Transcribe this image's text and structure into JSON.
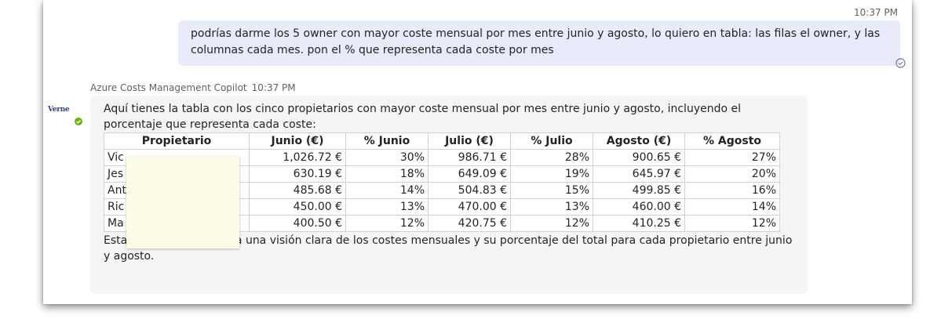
{
  "user_message": {
    "time": "10:37 PM",
    "text": "podrías darme los 5 owner con mayor coste mensual por mes entre junio y agosto, lo quiero en tabla: las filas el owner, y las columnas cada mes. pon el % que representa cada coste por mes"
  },
  "bot_message": {
    "sender": "Azure Costs Management Copilot",
    "time": "10:37 PM",
    "avatar_logo": "Verne",
    "intro": "Aquí tienes la tabla con los cinco propietarios con mayor coste mensual por mes entre junio y agosto, incluyendo el porcentaje que representa cada coste:",
    "outro": "Esta tabla te proporciona una visión clara de los costes mensuales y su porcentaje del total para cada propietario entre junio y agosto."
  },
  "table": {
    "headers": [
      "Propietario",
      "Junio (€)",
      "% Junio",
      "Julio (€)",
      "% Julio",
      "Agosto (€)",
      "% Agosto"
    ],
    "rows": [
      [
        "Vic",
        "1,026.72 €",
        "30%",
        "986.71 €",
        "28%",
        "900.65 €",
        "27%"
      ],
      [
        "Jes",
        "630.19 €",
        "18%",
        "649.09 €",
        "19%",
        "645.97 €",
        "20%"
      ],
      [
        "Ant",
        "485.68 €",
        "14%",
        "504.83 €",
        "15%",
        "499.85 €",
        "16%"
      ],
      [
        "Ric",
        "450.00 €",
        "13%",
        "470.00 €",
        "13%",
        "460.00 €",
        "14%"
      ],
      [
        "Ma",
        "400.50 €",
        "12%",
        "420.75 €",
        "12%",
        "410.25 €",
        "12%"
      ]
    ]
  },
  "colors": {
    "user_bubble": "#e8ebfa",
    "bot_bubble": "#f5f5f5",
    "presence": "#6bb700",
    "redaction": "#fbfbe6"
  },
  "icons": {
    "read_receipt": "check-circle-icon",
    "presence": "available-check-icon"
  }
}
